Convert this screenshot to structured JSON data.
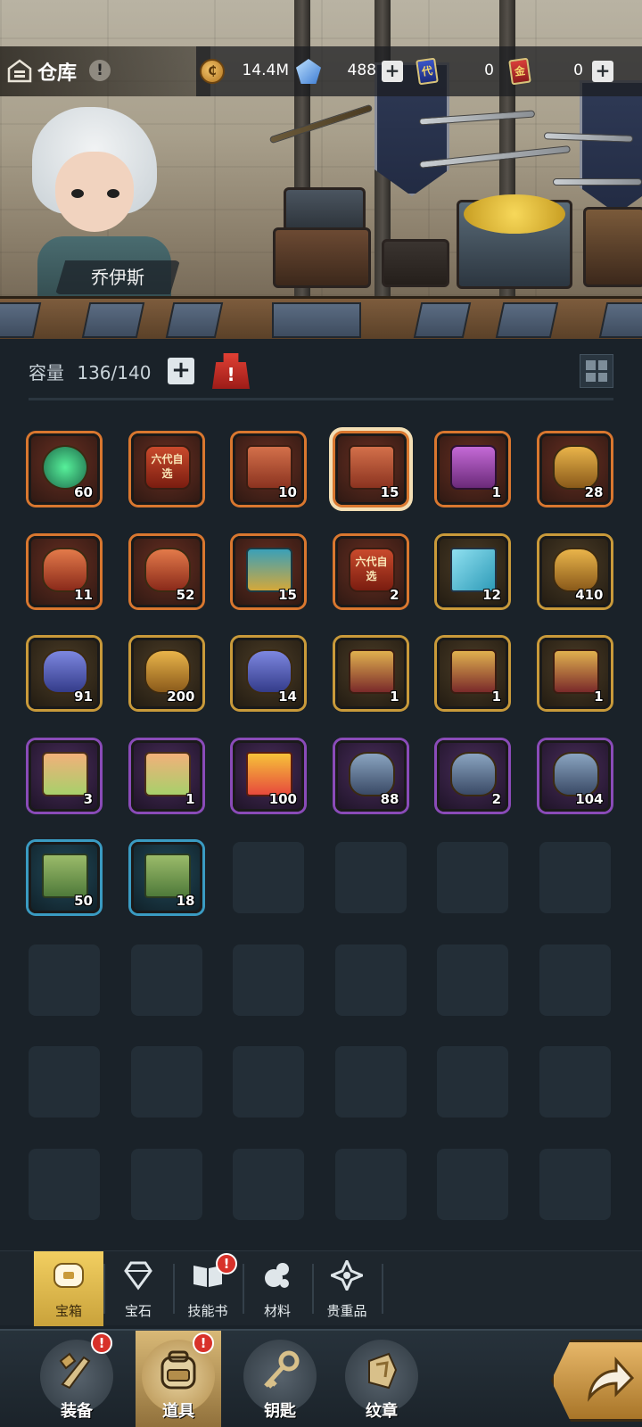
{
  "header": {
    "title": "仓库",
    "info_glyph": "!",
    "character_name": "乔伊斯"
  },
  "resources": [
    {
      "icon": "coin-icon",
      "value": "14.4M",
      "has_plus": false
    },
    {
      "icon": "crystal-icon",
      "value": "488",
      "has_plus": true
    },
    {
      "icon": "blue-card-icon",
      "glyph": "代",
      "value": "0",
      "has_plus": false
    },
    {
      "icon": "red-card-icon",
      "glyph": "金",
      "value": "0",
      "has_plus": true
    }
  ],
  "capacity": {
    "label": "容量",
    "value": "136/140",
    "plus": "+",
    "bag_glyph": "!"
  },
  "items": [
    {
      "art": "gem",
      "count": "60",
      "rarity": "orange"
    },
    {
      "art": "six",
      "count": "",
      "rarity": "orange",
      "text": "六代自选"
    },
    {
      "art": "chest-a",
      "count": "10",
      "rarity": "orange"
    },
    {
      "art": "chest-a",
      "count": "15",
      "rarity": "orange",
      "selected": true
    },
    {
      "art": "pinkbox",
      "count": "1",
      "rarity": "orange"
    },
    {
      "art": "vase-gold",
      "count": "28",
      "rarity": "orange"
    },
    {
      "art": "vase-red",
      "count": "11",
      "rarity": "orange"
    },
    {
      "art": "vase-red",
      "count": "52",
      "rarity": "orange"
    },
    {
      "art": "teal",
      "count": "15",
      "rarity": "orange"
    },
    {
      "art": "six",
      "count": "2",
      "rarity": "orange",
      "text": "六代自选"
    },
    {
      "art": "box",
      "count": "12",
      "rarity": "gold"
    },
    {
      "art": "vase-gold",
      "count": "410",
      "rarity": "gold"
    },
    {
      "art": "vase-blue",
      "count": "91",
      "rarity": "gold"
    },
    {
      "art": "vase-gold",
      "count": "200",
      "rarity": "gold"
    },
    {
      "art": "vase-blue",
      "count": "14",
      "rarity": "gold"
    },
    {
      "art": "ornate",
      "count": "1",
      "rarity": "gold"
    },
    {
      "art": "ornate",
      "count": "1",
      "rarity": "gold"
    },
    {
      "art": "ornate",
      "count": "1",
      "rarity": "gold"
    },
    {
      "art": "bento",
      "count": "3",
      "rarity": "purple"
    },
    {
      "art": "bento",
      "count": "1",
      "rarity": "purple"
    },
    {
      "art": "gift",
      "count": "100",
      "rarity": "purple"
    },
    {
      "art": "vase-steel",
      "count": "88",
      "rarity": "purple"
    },
    {
      "art": "vase-steel",
      "count": "2",
      "rarity": "purple"
    },
    {
      "art": "vase-steel",
      "count": "104",
      "rarity": "purple"
    },
    {
      "art": "crate",
      "count": "50",
      "rarity": "blue"
    },
    {
      "art": "crate",
      "count": "18",
      "rarity": "blue"
    }
  ],
  "categories": [
    {
      "label": "宝箱",
      "icon": "chest-icon",
      "active": true,
      "badge": false
    },
    {
      "label": "宝石",
      "icon": "diamond-icon",
      "active": false,
      "badge": false
    },
    {
      "label": "技能书",
      "icon": "book-icon",
      "active": false,
      "badge": true
    },
    {
      "label": "材料",
      "icon": "materials-icon",
      "active": false,
      "badge": false
    },
    {
      "label": "贵重品",
      "icon": "valuables-icon",
      "active": false,
      "badge": false
    }
  ],
  "bottom_nav": [
    {
      "label": "装备",
      "icon": "equipment-icon",
      "active": false,
      "badge": true
    },
    {
      "label": "道具",
      "icon": "backpack-icon",
      "active": true,
      "badge": true
    },
    {
      "label": "钥匙",
      "icon": "key-icon",
      "active": false,
      "badge": false
    },
    {
      "label": "纹章",
      "icon": "emblem-icon",
      "active": false,
      "badge": false
    }
  ],
  "badge_glyph": "!",
  "colors": {
    "rarity_orange": "#d9772f",
    "rarity_gold": "#c99a3a",
    "rarity_purple": "#8a4bb8",
    "rarity_blue": "#3a9bc2",
    "accent_gold": "#f2cf61"
  }
}
